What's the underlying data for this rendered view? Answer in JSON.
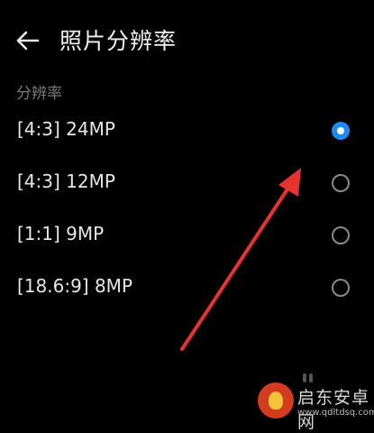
{
  "header": {
    "back_icon": "arrow-left-icon",
    "title": "照片分辨率"
  },
  "section": {
    "title": "分辨率"
  },
  "options": [
    {
      "label": "[4:3] 24MP",
      "selected": true
    },
    {
      "label": "[4:3] 12MP",
      "selected": false
    },
    {
      "label": "[1:1] 9MP",
      "selected": false
    },
    {
      "label": "[18.6:9] 8MP",
      "selected": false
    }
  ],
  "colors": {
    "background": "#000000",
    "accent": "#1d8bf2",
    "annotation_arrow": "#e8322f"
  },
  "watermark": {
    "name": "启东安卓网",
    "url": "www.qdltdsq.com"
  }
}
